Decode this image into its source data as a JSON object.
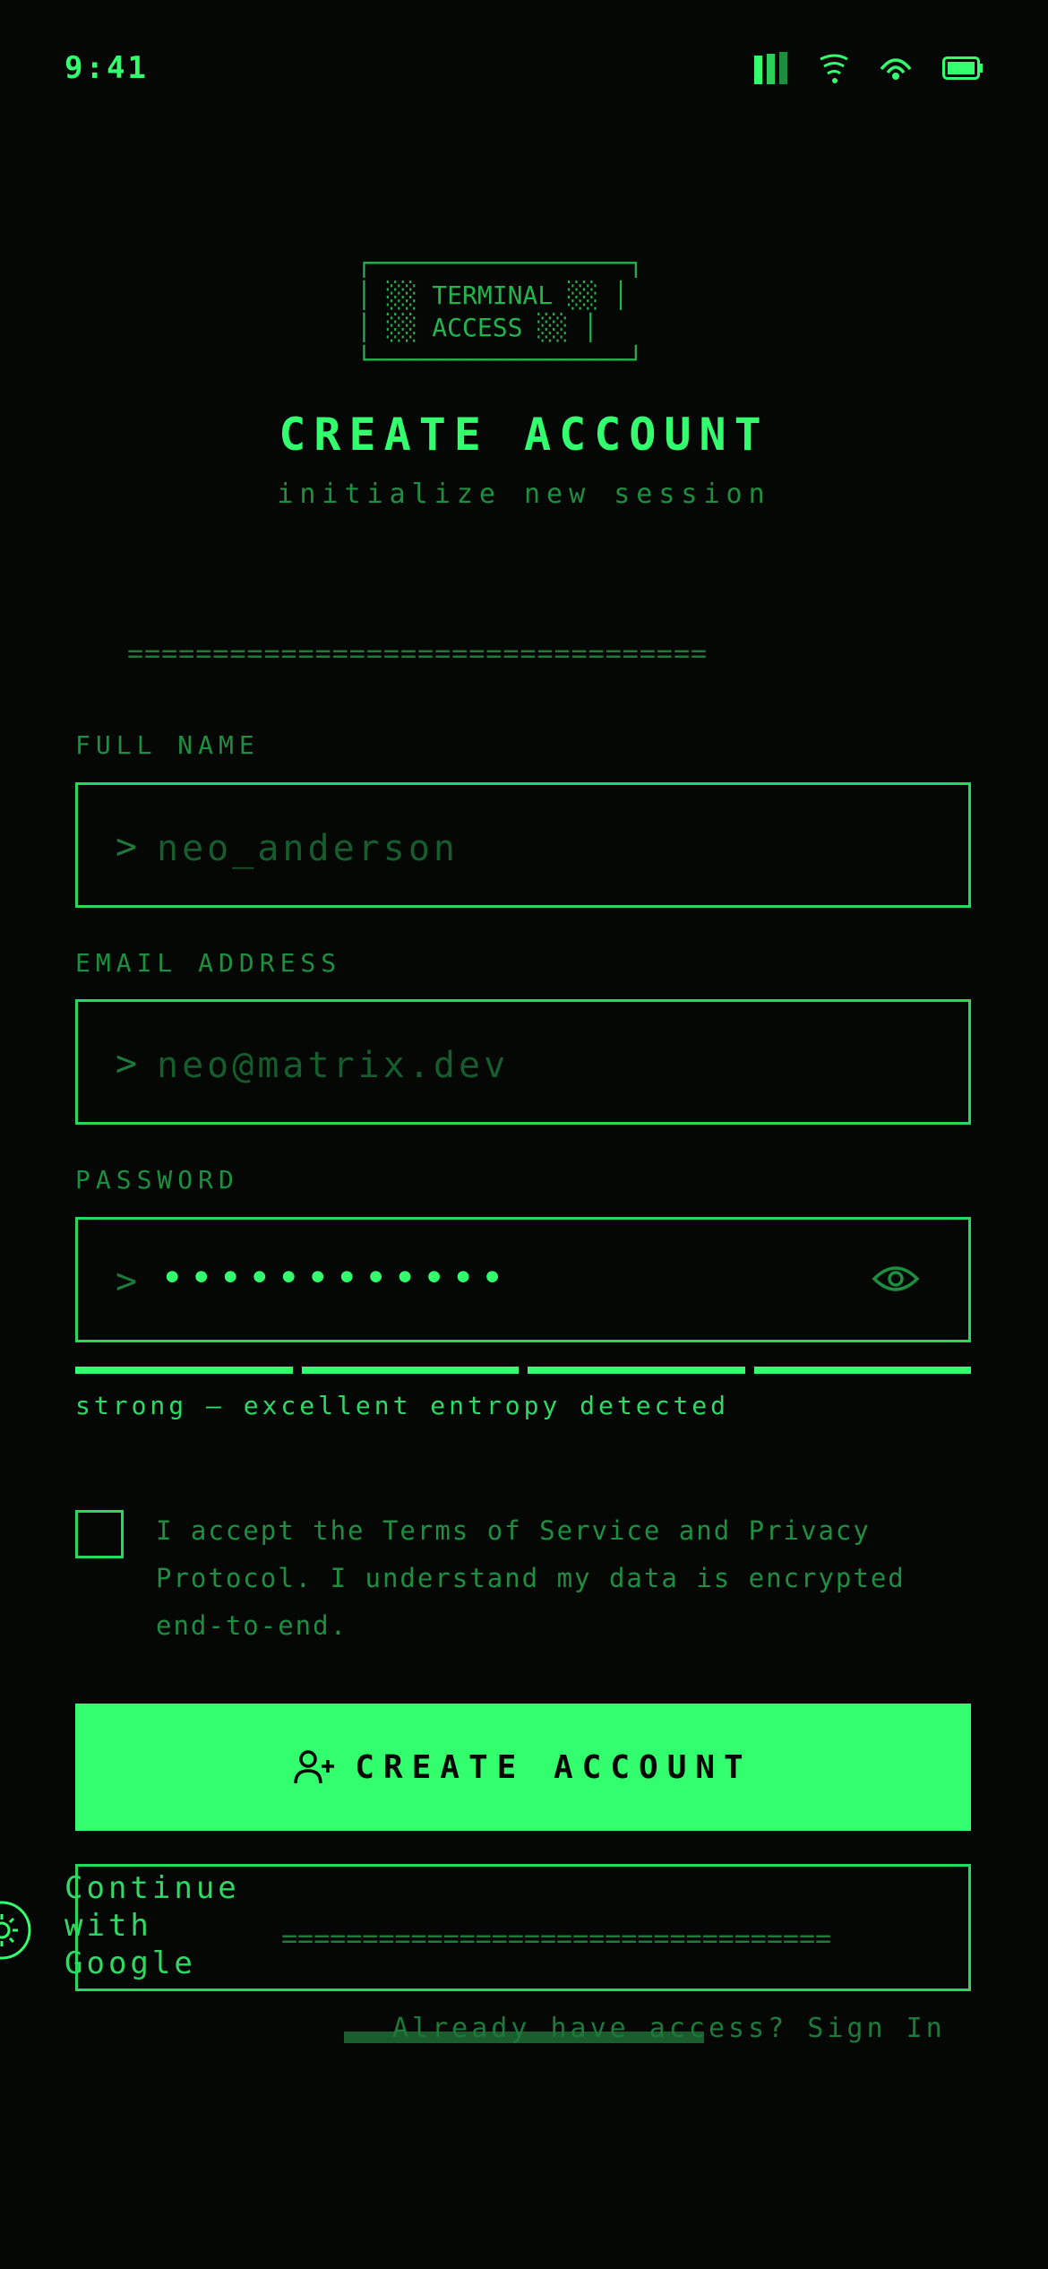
{
  "status": {
    "time": "9:41"
  },
  "banner": {
    "art": "┌─────────────────┐\n│ ░░ TERMINAL ░░ │\n│ ░░ ACCESS ░░ │\n└─────────────────┘"
  },
  "header": {
    "title": "CREATE ACCOUNT",
    "subtitle": "initialize new session"
  },
  "divider": "==================================",
  "form": {
    "full_name": {
      "label": "FULL NAME",
      "prompt": ">",
      "placeholder": "neo_anderson"
    },
    "email": {
      "label": "EMAIL ADDRESS",
      "prompt": ">",
      "placeholder": "neo@matrix.dev"
    },
    "password": {
      "label": "PASSWORD",
      "prompt": ">",
      "masked_value": "••••••••••••",
      "icon": "eye-icon"
    },
    "strength": {
      "segments_filled": 4,
      "segments_total": 4,
      "text": "strong — excellent entropy detected"
    },
    "terms": {
      "checked": false,
      "text": "I accept the Terms of Service and Privacy Protocol. I understand my data is encrypted end-to-end."
    }
  },
  "actions": {
    "create_label": "CREATE ACCOUNT",
    "create_icon": "user-plus-icon",
    "google_label": "Continue with Google",
    "google_icon": "sun-icon",
    "google_divider": "==================================",
    "signin_text": "Already have access? Sign In"
  },
  "colors": {
    "accent": "#33ff6e",
    "background": "#050705",
    "dim": "#1e8f40"
  }
}
